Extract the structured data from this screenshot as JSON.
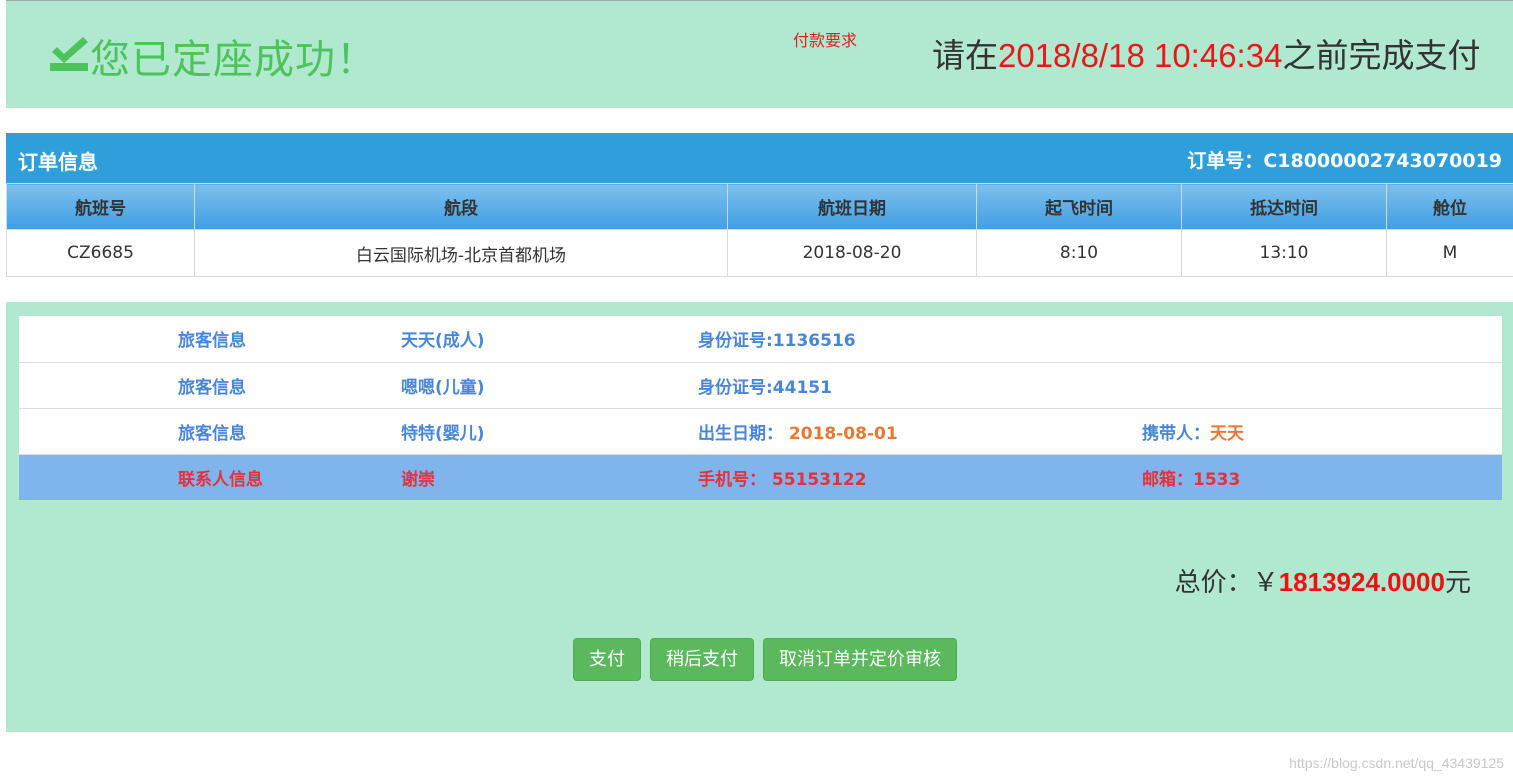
{
  "banner": {
    "success_text": "您已定座成功！",
    "payment_requirement_link": "付款要求",
    "deadline_prefix": "请在",
    "deadline_datetime": "2018/8/18 10:46:34",
    "deadline_suffix": "之前完成支付"
  },
  "order": {
    "title": "订单信息",
    "order_number_label": "订单号：",
    "order_number": "C18000002743070019",
    "columns": [
      "航班号",
      "航段",
      "航班日期",
      "起飞时间",
      "抵达时间",
      "舱位"
    ],
    "flight": {
      "flight_no": "CZ6685",
      "route": "白云国际机场-北京首都机场",
      "date": "2018-08-20",
      "departure": "8:10",
      "arrival": "13:10",
      "cabin": "M"
    }
  },
  "passengers": [
    {
      "label": "旅客信息",
      "name": "天天(成人)",
      "id_text": "身份证号:1136516"
    },
    {
      "label": "旅客信息",
      "name": "嗯嗯(儿童)",
      "id_text": "身份证号:44151"
    },
    {
      "label": "旅客信息",
      "name": "特特(婴儿)",
      "birth_label": "出生日期：",
      "birth_date": "2018-08-01",
      "carrier_label": "携带人：",
      "carrier": "天天"
    }
  ],
  "contact": {
    "label": "联系人信息",
    "name": "谢崇",
    "phone_label": "手机号：",
    "phone": "55153122",
    "email_label": "邮箱：",
    "email": "1533"
  },
  "total": {
    "label": "总价：￥",
    "amount": "1813924.0000",
    "unit": "元"
  },
  "buttons": {
    "pay": "支付",
    "pay_later": "稍后支付",
    "cancel_and_review": "取消订单并定价审核"
  },
  "watermark": "https://blog.csdn.net/qq_43439125",
  "colors": {
    "banner_bg": "#b0e8d0",
    "order_header": "#2f9fdc",
    "success_green": "#4cc45a",
    "deadline_red": "#e81818",
    "button_green": "#5cb85c"
  }
}
